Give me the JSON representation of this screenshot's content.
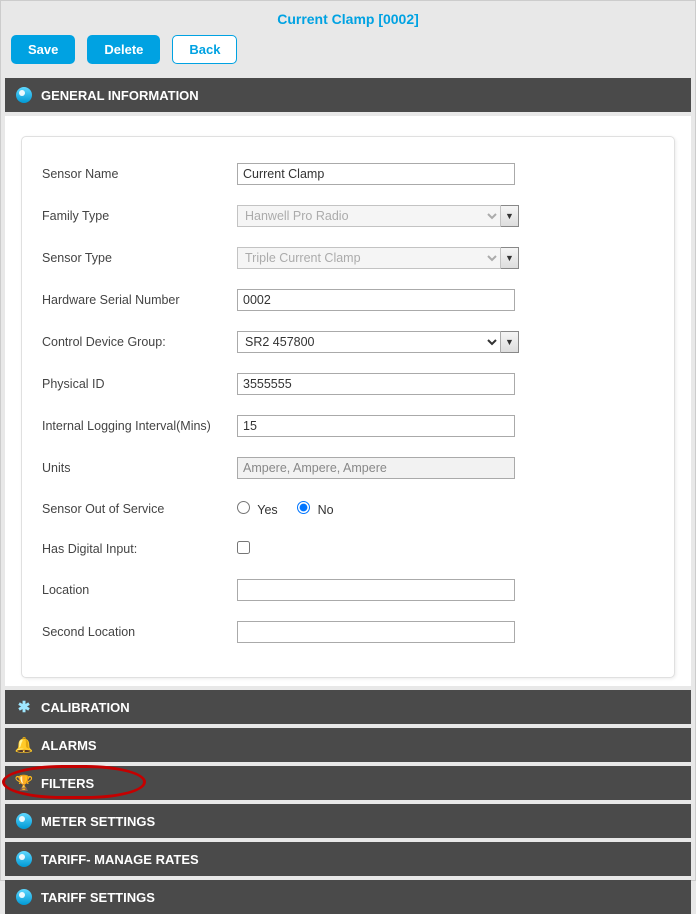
{
  "title": "Current Clamp [0002]",
  "buttons": {
    "save": "Save",
    "delete": "Delete",
    "back": "Back"
  },
  "sections": {
    "general": "GENERAL INFORMATION",
    "calibration": "CALIBRATION",
    "alarms": "ALARMS",
    "filters": "FILTERS",
    "meter": "METER SETTINGS",
    "tariffRates": "TARIFF- MANAGE RATES",
    "tariffSettings": "TARIFF SETTINGS"
  },
  "form": {
    "sensorName": {
      "label": "Sensor Name",
      "value": "Current Clamp"
    },
    "familyType": {
      "label": "Family Type",
      "value": "Hanwell Pro Radio"
    },
    "sensorType": {
      "label": "Sensor Type",
      "value": "Triple Current Clamp"
    },
    "hwSerial": {
      "label": "Hardware Serial Number",
      "value": "0002"
    },
    "controlGroup": {
      "label": "Control Device Group:",
      "value": "SR2 457800"
    },
    "physicalId": {
      "label": "Physical ID",
      "value": "3555555"
    },
    "logInterval": {
      "label": "Internal Logging Interval(Mins)",
      "value": "15"
    },
    "units": {
      "label": "Units",
      "value": "Ampere, Ampere, Ampere"
    },
    "outOfService": {
      "label": "Sensor Out of Service",
      "yes": "Yes",
      "no": "No",
      "value": "No"
    },
    "hasDigital": {
      "label": "Has Digital Input:",
      "value": false
    },
    "location": {
      "label": "Location",
      "value": ""
    },
    "secondLocation": {
      "label": "Second Location",
      "value": ""
    }
  }
}
